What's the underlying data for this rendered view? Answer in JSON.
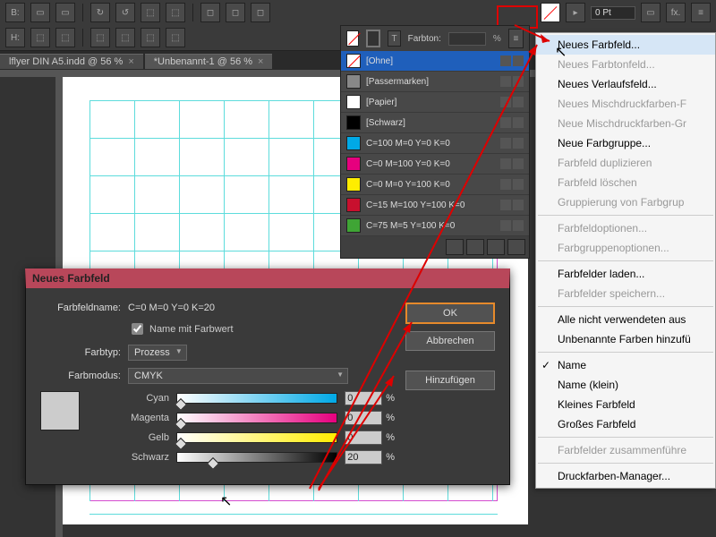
{
  "toolbar": {
    "pt_label": "0 Pt",
    "farbton_label": "Farbton:"
  },
  "tabs": [
    {
      "label": "lflyer DIN A5.indd @ 56 %"
    },
    {
      "label": "*Unbenannt-1 @ 56 %"
    }
  ],
  "swatches": {
    "farbton_label": "Farbton:",
    "pct_value": "",
    "items": [
      {
        "name": "[Ohne]",
        "chip": "none",
        "selected": true
      },
      {
        "name": "[Passermarken]",
        "chip": "#888"
      },
      {
        "name": "[Papier]",
        "chip": "#fff"
      },
      {
        "name": "[Schwarz]",
        "chip": "#000"
      },
      {
        "name": "C=100 M=0 Y=0 K=0",
        "chip": "#00a9e6"
      },
      {
        "name": "C=0 M=100 Y=0 K=0",
        "chip": "#e6007e"
      },
      {
        "name": "C=0 M=0 Y=100 K=0",
        "chip": "#ffed00"
      },
      {
        "name": "C=15 M=100 Y=100 K=0",
        "chip": "#c8102e"
      },
      {
        "name": "C=75 M=5 Y=100 K=0",
        "chip": "#3fa535"
      }
    ]
  },
  "menu": {
    "items": [
      {
        "label": "Neues Farbfeld...",
        "state": "hl"
      },
      {
        "label": "Neues Farbtonfeld...",
        "state": "disabled"
      },
      {
        "label": "Neues Verlaufsfeld..."
      },
      {
        "label": "Neues Mischdruckfarben-F",
        "state": "disabled"
      },
      {
        "label": "Neue Mischdruckfarben-Gr",
        "state": "disabled"
      },
      {
        "label": "Neue Farbgruppe..."
      },
      {
        "label": "Farbfeld duplizieren",
        "state": "disabled"
      },
      {
        "label": "Farbfeld löschen",
        "state": "disabled"
      },
      {
        "label": "Gruppierung von Farbgrup",
        "state": "disabled"
      },
      {
        "sep": true
      },
      {
        "label": "Farbfeldoptionen...",
        "state": "disabled"
      },
      {
        "label": "Farbgruppenoptionen...",
        "state": "disabled"
      },
      {
        "sep": true
      },
      {
        "label": "Farbfelder laden..."
      },
      {
        "label": "Farbfelder speichern...",
        "state": "disabled"
      },
      {
        "sep": true
      },
      {
        "label": "Alle nicht verwendeten aus"
      },
      {
        "label": "Unbenannte Farben hinzufü"
      },
      {
        "sep": true
      },
      {
        "label": "Name",
        "checked": true
      },
      {
        "label": "Name (klein)"
      },
      {
        "label": "Kleines Farbfeld"
      },
      {
        "label": "Großes Farbfeld"
      },
      {
        "sep": true
      },
      {
        "label": "Farbfelder zusammenführe",
        "state": "disabled"
      },
      {
        "sep": true
      },
      {
        "label": "Druckfarben-Manager..."
      }
    ]
  },
  "dialog": {
    "title": "Neues Farbfeld",
    "farbfeldname_label": "Farbfeldname:",
    "farbfeldname_value": "C=0 M=0 Y=0 K=20",
    "name_mit_farbwert": "Name mit Farbwert",
    "farbtyp_label": "Farbtyp:",
    "farbtyp_value": "Prozess",
    "farbmodus_label": "Farbmodus:",
    "farbmodus_value": "CMYK",
    "sliders": [
      {
        "label": "Cyan",
        "value": "0",
        "grad": "linear-gradient(90deg,#fff,#00a9e6)",
        "pos": 0
      },
      {
        "label": "Magenta",
        "value": "0",
        "grad": "linear-gradient(90deg,#fff,#e6007e)",
        "pos": 0
      },
      {
        "label": "Gelb",
        "value": "0",
        "grad": "linear-gradient(90deg,#fff,#ffed00)",
        "pos": 0
      },
      {
        "label": "Schwarz",
        "value": "20",
        "grad": "linear-gradient(90deg,#fff,#000)",
        "pos": 20
      }
    ],
    "buttons": {
      "ok": "OK",
      "cancel": "Abbrechen",
      "add": "Hinzufügen"
    }
  }
}
